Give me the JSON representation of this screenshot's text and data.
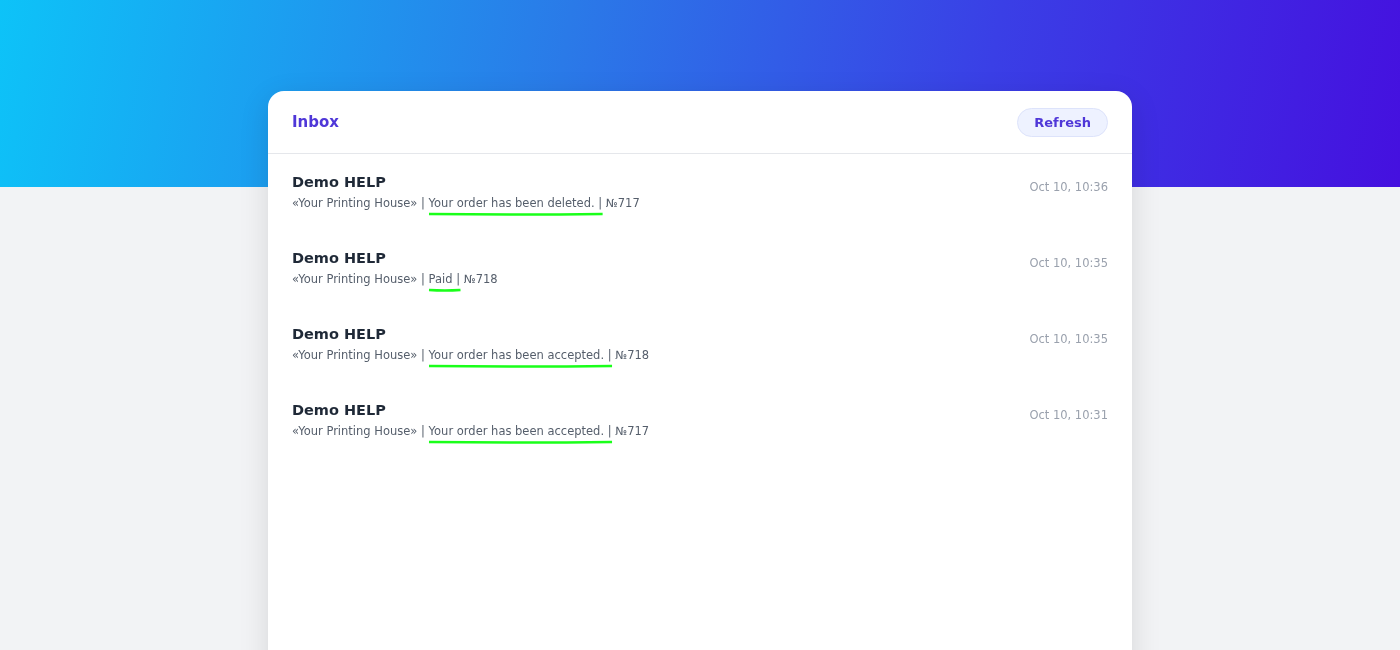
{
  "inbox": {
    "title": "Inbox",
    "refresh_button": "Refresh"
  },
  "messages": [
    {
      "sender": "Demo HELP",
      "preview": {
        "before": "«Your Printing House» | ",
        "marked": "Your order has been deleted. |",
        "after": " №717"
      },
      "time": "Oct 10, 10:36"
    },
    {
      "sender": "Demo HELP",
      "preview": {
        "before": "«Your Printing House» | ",
        "marked": "Paid |",
        "after": " №718"
      },
      "time": "Oct 10, 10:35"
    },
    {
      "sender": "Demo HELP",
      "preview": {
        "before": "«Your Printing House» | ",
        "marked": "Your order has been accepted. |",
        "after": " №718"
      },
      "time": "Oct 10, 10:35"
    },
    {
      "sender": "Demo HELP",
      "preview": {
        "before": "«Your Printing House» | ",
        "marked": "Your order has been accepted. |",
        "after": " №717"
      },
      "time": "Oct 10, 10:31"
    }
  ]
}
